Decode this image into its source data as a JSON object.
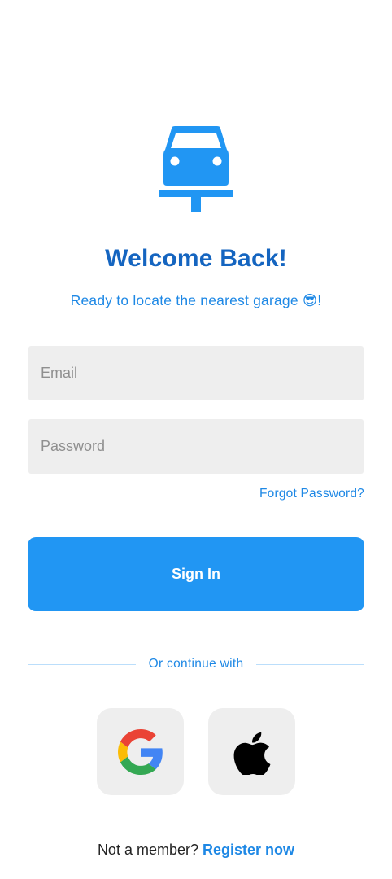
{
  "header": {
    "logo_icon": "car-lift-icon",
    "title": "Welcome Back!",
    "subtitle": "Ready to locate the nearest garage 😎!"
  },
  "form": {
    "email_placeholder": "Email",
    "email_value": "",
    "password_placeholder": "Password",
    "password_value": "",
    "forgot_password_label": "Forgot Password?",
    "sign_in_label": "Sign In"
  },
  "social": {
    "divider_text": "Or continue with",
    "providers": [
      {
        "icon": "google-icon"
      },
      {
        "icon": "apple-icon"
      }
    ]
  },
  "footer": {
    "prompt": "Not a member?",
    "register_label": "Register now"
  },
  "colors": {
    "primary": "#2196F3",
    "title_blue": "#1565C0",
    "accent_text": "#1E88E5",
    "field_bg": "#EEEEEE"
  }
}
